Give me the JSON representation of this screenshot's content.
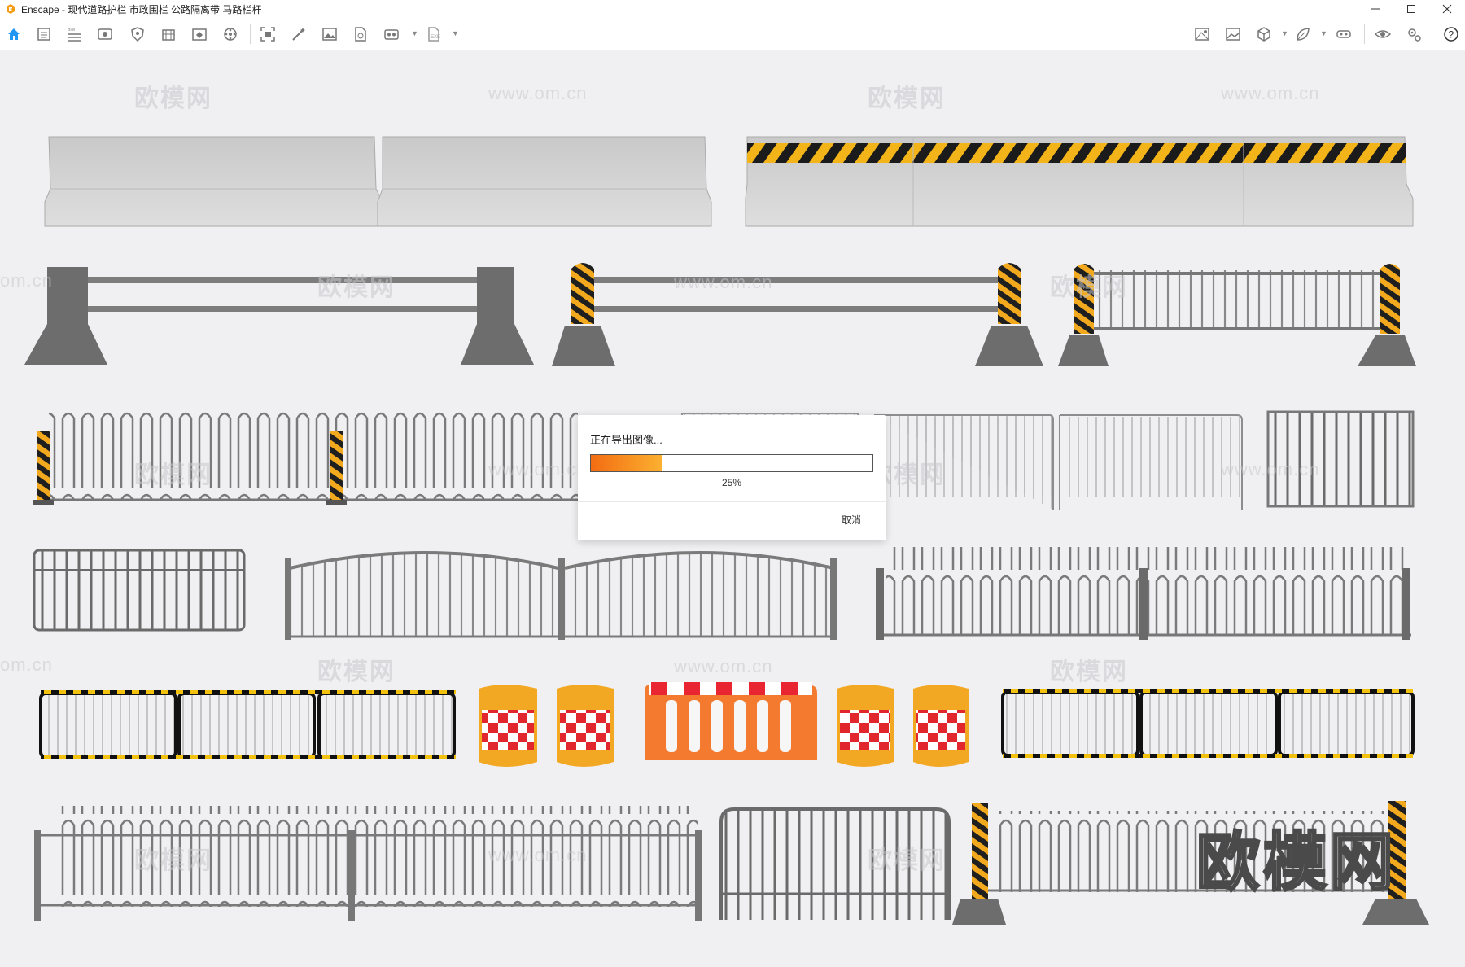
{
  "window": {
    "title": "Enscape - 现代道路护栏 市政围栏 公路隔离带 马路栏杆",
    "controls": [
      "minimize-icon",
      "maximize-icon",
      "close-icon"
    ]
  },
  "toolbar": {
    "left_icons": [
      "home-icon",
      "file-icon",
      "bim-list-icon",
      "view-icon",
      "shield-icon",
      "building-icon",
      "asset-library-icon",
      "settings-wheel-icon",
      "screenshot-icon",
      "magic-wand-icon",
      "image-icon",
      "export-file-icon",
      "batch-render-icon",
      "export-icon"
    ],
    "right_icons": [
      "map-icon",
      "gallery-icon",
      "cube-icon",
      "leaf-icon",
      "vr-headset-icon",
      "visibility-icon",
      "visual-settings-icon",
      "help-icon"
    ]
  },
  "scene": {
    "watermark_text": "欧模网",
    "watermark_url": "www.om.cn",
    "url_fragment": "om.cn"
  },
  "dialog": {
    "title": "正在导出图像...",
    "progress": 0.25,
    "progress_label": "25%",
    "cancel_label": "取消"
  }
}
